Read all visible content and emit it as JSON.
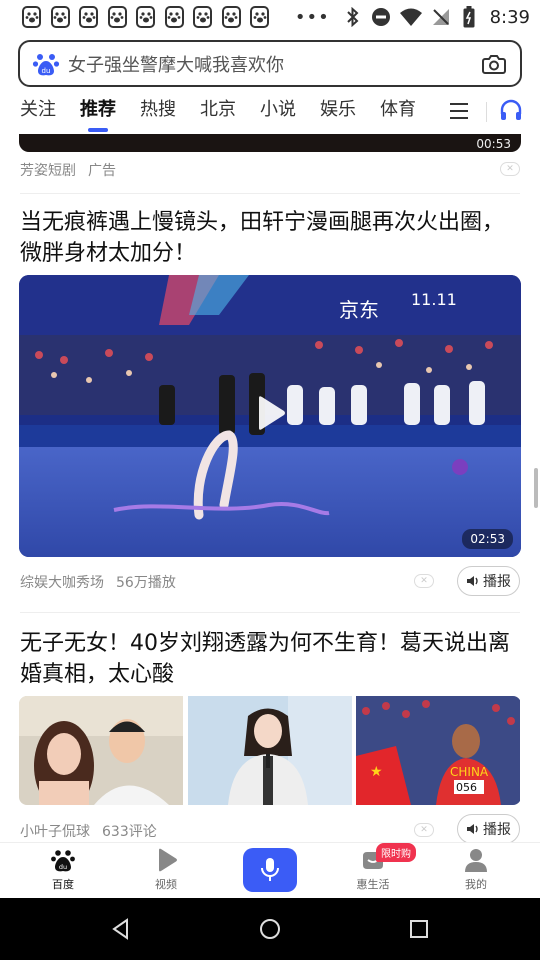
{
  "status_bar": {
    "time": "8:39",
    "dots": "•••"
  },
  "search": {
    "query": "女子强坐警摩大喊我喜欢你"
  },
  "tabs": [
    {
      "label": "关注"
    },
    {
      "label": "推荐"
    },
    {
      "label": "热搜"
    },
    {
      "label": "北京"
    },
    {
      "label": "小说"
    },
    {
      "label": "娱乐"
    },
    {
      "label": "体育"
    }
  ],
  "prev_item": {
    "duration": "00:53",
    "source": "芳姿短剧",
    "tag": "广告"
  },
  "article1": {
    "title": "当无痕裤遇上慢镜头，田轩宁漫画腿再次火出圈，微胖身材太加分！",
    "duration": "02:53",
    "ad_text_brand": "京东",
    "ad_text_event": "11.11",
    "source": "综娱大咖秀场",
    "plays": "56万播放",
    "broadcast": "播报"
  },
  "article2": {
    "title": "无子无女！40岁刘翔透露为何不生育！葛天说出离婚真相，太心酸",
    "jersey_text": "CHINA",
    "jersey_number": "056",
    "source": "小叶子侃球",
    "comments": "633评论",
    "broadcast": "播报"
  },
  "bottom_nav": {
    "home": "百度",
    "video": "视频",
    "life": "惠生活",
    "life_badge": "限时购",
    "mine": "我的"
  },
  "colors": {
    "accent": "#3a5cf5",
    "badge": "#f0334f"
  }
}
